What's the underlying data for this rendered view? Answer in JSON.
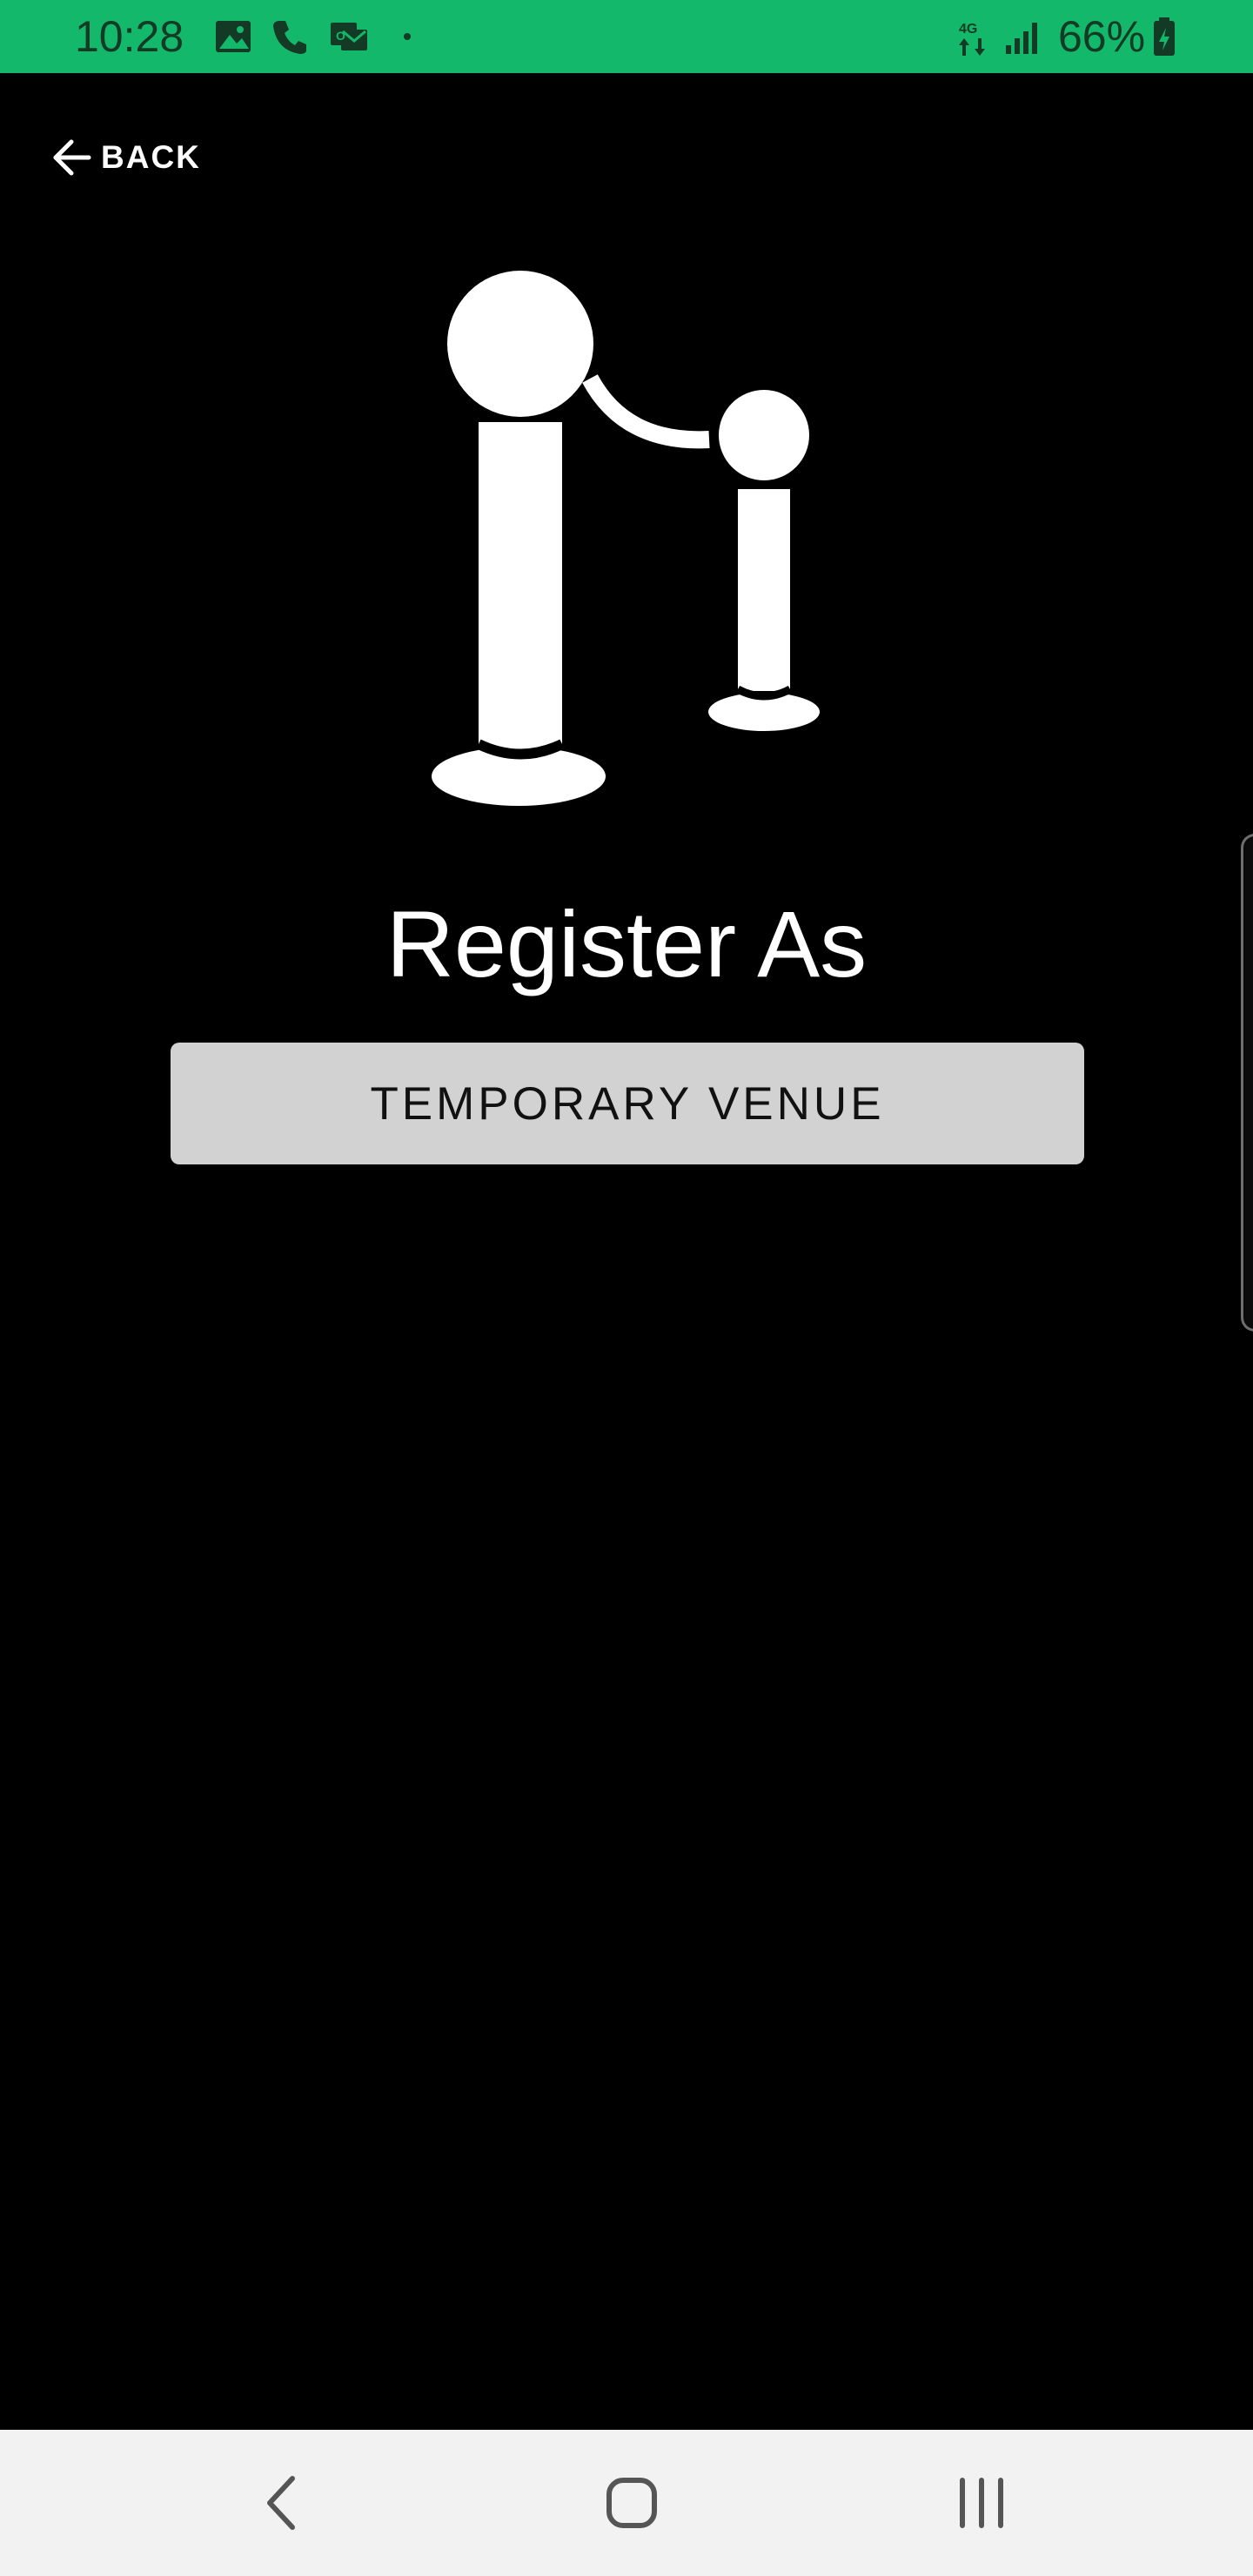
{
  "status_bar": {
    "time": "10:28",
    "battery": "66%",
    "color": "#13b86a",
    "icons": [
      "gallery-icon",
      "phone-icon",
      "email-icon",
      "dot-icon",
      "data-transfer-icon",
      "signal-icon",
      "battery-icon"
    ]
  },
  "header": {
    "back_label": "BACK",
    "back_icon": "arrow-left-icon"
  },
  "illustration": {
    "icon": "stanchion-barrier-icon"
  },
  "main": {
    "title": "Register As",
    "option_button_label": "TEMPORARY VENUE",
    "option_button_color": "#d2d2d2"
  },
  "nav_bar": {
    "buttons": [
      "back-nav-icon",
      "home-nav-icon",
      "recents-nav-icon"
    ]
  }
}
